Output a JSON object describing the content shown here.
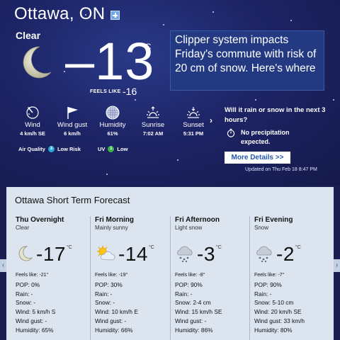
{
  "location": {
    "city": "Ottawa, ON",
    "add_icon": "plus-icon"
  },
  "current": {
    "condition": "Clear",
    "temperature": "–13",
    "unit": "°C",
    "feels_like_label": "FEELS LIKE",
    "feels_like_value": "-16"
  },
  "news": {
    "headline": "Clipper system impacts Friday's commute with risk of 20 cm of snow. Here's where"
  },
  "metrics": [
    {
      "icon": "wind-icon",
      "label": "Wind",
      "value": "4 km/h SE"
    },
    {
      "icon": "wind-gust-icon",
      "label": "Wind gust",
      "value": "6 km/h"
    },
    {
      "icon": "humidity-icon",
      "label": "Humidity",
      "value": "61%"
    },
    {
      "icon": "sunrise-icon",
      "label": "Sunrise",
      "value": "7:02 AM"
    },
    {
      "icon": "sunset-icon",
      "label": "Sunset",
      "value": "5:31 PM"
    }
  ],
  "air_quality": {
    "label": "Air Quality",
    "index": "3",
    "risk": "Low Risk",
    "color": "#2aa8d8"
  },
  "uv": {
    "label": "UV",
    "index": "1",
    "level": "Low",
    "color": "#3bb54a"
  },
  "precip": {
    "question": "Will it rain or snow in the next 3 hours?",
    "answer": "No precipitation expected.",
    "more_label": "More Details >>"
  },
  "updated": "Updated on Thu Feb 18 8:47 PM",
  "forecast": {
    "title": "Ottawa Short Term Forecast",
    "columns": [
      {
        "period": "Thu Overnight",
        "summary": "Clear",
        "icon": "moon-icon",
        "temp": "-17",
        "unit": "°C",
        "feels_like": "Feels like: -21°",
        "pop": "POP: 0%",
        "rain": "Rain: -",
        "snow": "Snow: -",
        "wind": "Wind: 5 km/h S",
        "wind_gust": "Wind gust: -",
        "humidity": "Humidity: 65%"
      },
      {
        "period": "Fri Morning",
        "summary": "Mainly sunny",
        "icon": "sun-cloud-icon",
        "temp": "-14",
        "unit": "°C",
        "feels_like": "Feels like: -19°",
        "pop": "POP: 30%",
        "rain": "Rain: -",
        "snow": "Snow: -",
        "wind": "Wind: 10 km/h E",
        "wind_gust": "Wind gust: -",
        "humidity": "Humidity: 66%"
      },
      {
        "period": "Fri Afternoon",
        "summary": "Light snow",
        "icon": "snow-cloud-icon",
        "temp": "-3",
        "unit": "°C",
        "feels_like": "Feels like: -8°",
        "pop": "POP: 90%",
        "rain": "Rain: -",
        "snow": "Snow: 2-4 cm",
        "wind": "Wind: 15 km/h SE",
        "wind_gust": "Wind gust: -",
        "humidity": "Humidity: 86%"
      },
      {
        "period": "Fri Evening",
        "summary": "Snow",
        "icon": "snow-cloud-icon",
        "temp": "-2",
        "unit": "°C",
        "feels_like": "Feels like: -7°",
        "pop": "POP: 90%",
        "rain": "Rain: -",
        "snow": "Snow: 5-10 cm",
        "wind": "Wind: 20 km/h SE",
        "wind_gust": "Wind gust: 33 km/h",
        "humidity": "Humidity: 80%"
      }
    ]
  }
}
